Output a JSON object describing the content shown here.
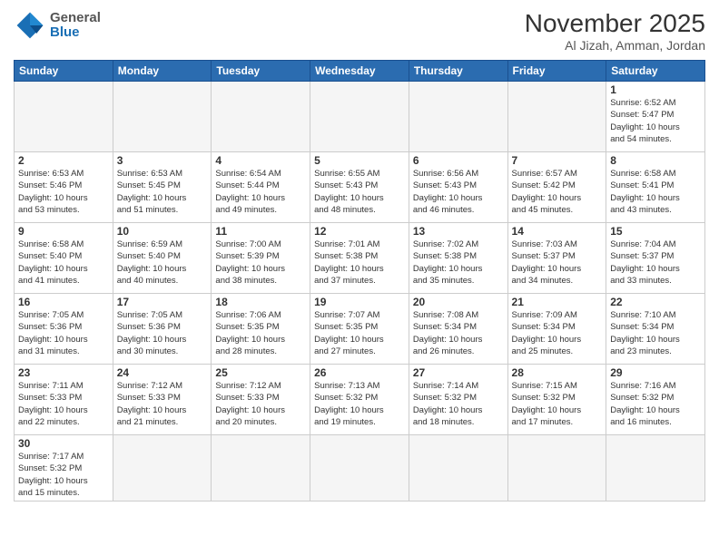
{
  "header": {
    "logo_general": "General",
    "logo_blue": "Blue",
    "month_year": "November 2025",
    "location": "Al Jizah, Amman, Jordan"
  },
  "weekdays": [
    "Sunday",
    "Monday",
    "Tuesday",
    "Wednesday",
    "Thursday",
    "Friday",
    "Saturday"
  ],
  "weeks": [
    [
      {
        "day": "",
        "info": ""
      },
      {
        "day": "",
        "info": ""
      },
      {
        "day": "",
        "info": ""
      },
      {
        "day": "",
        "info": ""
      },
      {
        "day": "",
        "info": ""
      },
      {
        "day": "",
        "info": ""
      },
      {
        "day": "1",
        "info": "Sunrise: 6:52 AM\nSunset: 5:47 PM\nDaylight: 10 hours\nand 54 minutes."
      }
    ],
    [
      {
        "day": "2",
        "info": "Sunrise: 6:53 AM\nSunset: 5:46 PM\nDaylight: 10 hours\nand 53 minutes."
      },
      {
        "day": "3",
        "info": "Sunrise: 6:53 AM\nSunset: 5:45 PM\nDaylight: 10 hours\nand 51 minutes."
      },
      {
        "day": "4",
        "info": "Sunrise: 6:54 AM\nSunset: 5:44 PM\nDaylight: 10 hours\nand 49 minutes."
      },
      {
        "day": "5",
        "info": "Sunrise: 6:55 AM\nSunset: 5:43 PM\nDaylight: 10 hours\nand 48 minutes."
      },
      {
        "day": "6",
        "info": "Sunrise: 6:56 AM\nSunset: 5:43 PM\nDaylight: 10 hours\nand 46 minutes."
      },
      {
        "day": "7",
        "info": "Sunrise: 6:57 AM\nSunset: 5:42 PM\nDaylight: 10 hours\nand 45 minutes."
      },
      {
        "day": "8",
        "info": "Sunrise: 6:58 AM\nSunset: 5:41 PM\nDaylight: 10 hours\nand 43 minutes."
      }
    ],
    [
      {
        "day": "9",
        "info": "Sunrise: 6:58 AM\nSunset: 5:40 PM\nDaylight: 10 hours\nand 41 minutes."
      },
      {
        "day": "10",
        "info": "Sunrise: 6:59 AM\nSunset: 5:40 PM\nDaylight: 10 hours\nand 40 minutes."
      },
      {
        "day": "11",
        "info": "Sunrise: 7:00 AM\nSunset: 5:39 PM\nDaylight: 10 hours\nand 38 minutes."
      },
      {
        "day": "12",
        "info": "Sunrise: 7:01 AM\nSunset: 5:38 PM\nDaylight: 10 hours\nand 37 minutes."
      },
      {
        "day": "13",
        "info": "Sunrise: 7:02 AM\nSunset: 5:38 PM\nDaylight: 10 hours\nand 35 minutes."
      },
      {
        "day": "14",
        "info": "Sunrise: 7:03 AM\nSunset: 5:37 PM\nDaylight: 10 hours\nand 34 minutes."
      },
      {
        "day": "15",
        "info": "Sunrise: 7:04 AM\nSunset: 5:37 PM\nDaylight: 10 hours\nand 33 minutes."
      }
    ],
    [
      {
        "day": "16",
        "info": "Sunrise: 7:05 AM\nSunset: 5:36 PM\nDaylight: 10 hours\nand 31 minutes."
      },
      {
        "day": "17",
        "info": "Sunrise: 7:05 AM\nSunset: 5:36 PM\nDaylight: 10 hours\nand 30 minutes."
      },
      {
        "day": "18",
        "info": "Sunrise: 7:06 AM\nSunset: 5:35 PM\nDaylight: 10 hours\nand 28 minutes."
      },
      {
        "day": "19",
        "info": "Sunrise: 7:07 AM\nSunset: 5:35 PM\nDaylight: 10 hours\nand 27 minutes."
      },
      {
        "day": "20",
        "info": "Sunrise: 7:08 AM\nSunset: 5:34 PM\nDaylight: 10 hours\nand 26 minutes."
      },
      {
        "day": "21",
        "info": "Sunrise: 7:09 AM\nSunset: 5:34 PM\nDaylight: 10 hours\nand 25 minutes."
      },
      {
        "day": "22",
        "info": "Sunrise: 7:10 AM\nSunset: 5:34 PM\nDaylight: 10 hours\nand 23 minutes."
      }
    ],
    [
      {
        "day": "23",
        "info": "Sunrise: 7:11 AM\nSunset: 5:33 PM\nDaylight: 10 hours\nand 22 minutes."
      },
      {
        "day": "24",
        "info": "Sunrise: 7:12 AM\nSunset: 5:33 PM\nDaylight: 10 hours\nand 21 minutes."
      },
      {
        "day": "25",
        "info": "Sunrise: 7:12 AM\nSunset: 5:33 PM\nDaylight: 10 hours\nand 20 minutes."
      },
      {
        "day": "26",
        "info": "Sunrise: 7:13 AM\nSunset: 5:32 PM\nDaylight: 10 hours\nand 19 minutes."
      },
      {
        "day": "27",
        "info": "Sunrise: 7:14 AM\nSunset: 5:32 PM\nDaylight: 10 hours\nand 18 minutes."
      },
      {
        "day": "28",
        "info": "Sunrise: 7:15 AM\nSunset: 5:32 PM\nDaylight: 10 hours\nand 17 minutes."
      },
      {
        "day": "29",
        "info": "Sunrise: 7:16 AM\nSunset: 5:32 PM\nDaylight: 10 hours\nand 16 minutes."
      }
    ],
    [
      {
        "day": "30",
        "info": "Sunrise: 7:17 AM\nSunset: 5:32 PM\nDaylight: 10 hours\nand 15 minutes."
      },
      {
        "day": "",
        "info": ""
      },
      {
        "day": "",
        "info": ""
      },
      {
        "day": "",
        "info": ""
      },
      {
        "day": "",
        "info": ""
      },
      {
        "day": "",
        "info": ""
      },
      {
        "day": "",
        "info": ""
      }
    ]
  ]
}
